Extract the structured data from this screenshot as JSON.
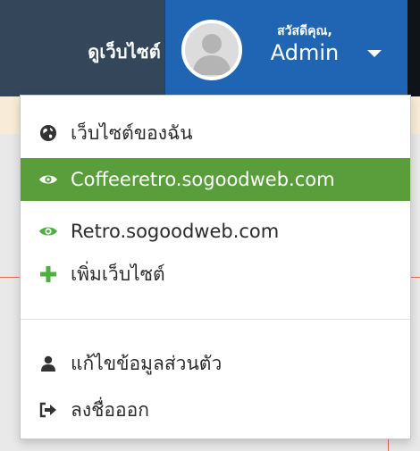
{
  "navbar": {
    "site_label": "ดูเว็บไซต์",
    "user": {
      "greeting": "สวัสดีคุณ,",
      "name": "Admin"
    }
  },
  "dropdown": {
    "items": [
      {
        "label": "เว็บไซต์ของฉัน",
        "icon": "globe-icon"
      },
      {
        "label": "Coffeeretro.sogoodweb.com",
        "icon": "eye-icon",
        "active": true
      },
      {
        "label": "Retro.sogoodweb.com",
        "icon": "eye-icon"
      },
      {
        "label": "เพิ่มเว็บไซต์",
        "icon": "plus-icon"
      },
      {
        "label": "แก้ไขข้อมูลส่วนตัว",
        "icon": "user-icon"
      },
      {
        "label": "ลงชื่อออก",
        "icon": "sign-out-icon"
      }
    ]
  },
  "colors": {
    "navbar": "#33465a",
    "user_box": "#1f65b3",
    "active_item": "#5a9e3c",
    "icon_green": "#4caf3e"
  }
}
